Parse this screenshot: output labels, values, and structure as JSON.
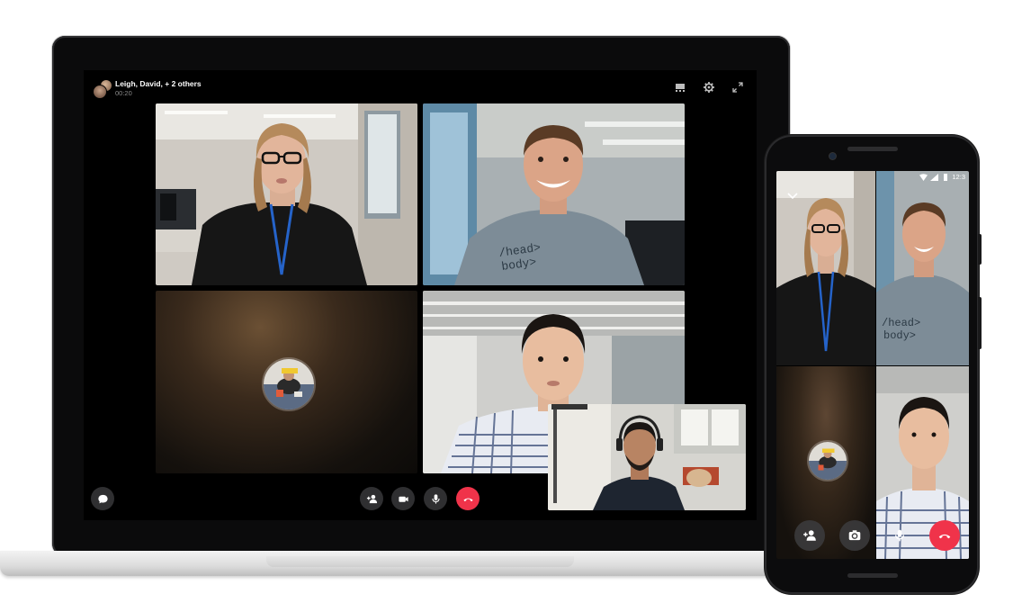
{
  "laptop": {
    "call": {
      "title": "Leigh, David, + 2 others",
      "timer": "00:20"
    },
    "top_icons": [
      "layout-icon",
      "gear-icon",
      "expand-icon"
    ],
    "participants": [
      {
        "id": "woman-glasses",
        "video": "on"
      },
      {
        "id": "man-smiling",
        "video": "on"
      },
      {
        "id": "video-off-avatar",
        "video": "off"
      },
      {
        "id": "man-checked-shirt",
        "video": "on"
      }
    ],
    "controls": [
      "chat-icon",
      "add-person-icon",
      "video-camera-icon",
      "microphone-icon",
      "end-call-icon"
    ],
    "colors": {
      "end_call": "#f0334a",
      "control_bg": "#2f2f31"
    }
  },
  "phone": {
    "status_time": "12:3",
    "controls": [
      "add-person-icon",
      "flip-camera-icon",
      "microphone-icon",
      "end-call-icon"
    ]
  }
}
